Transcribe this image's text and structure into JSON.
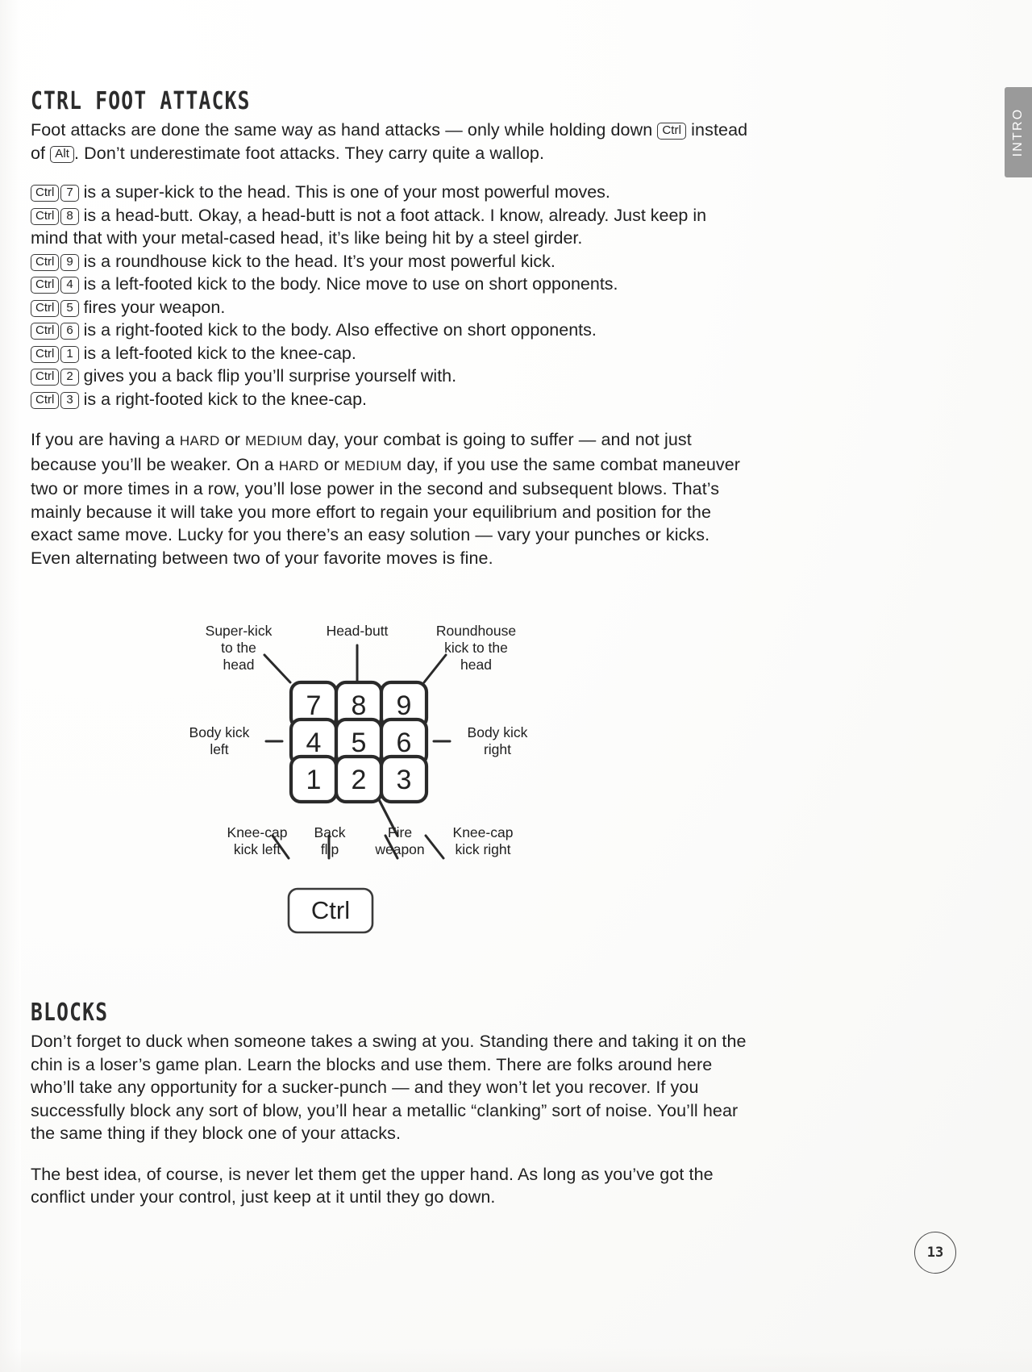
{
  "page": {
    "number": "13",
    "side_tab": "INTRO"
  },
  "sections": [
    {
      "id": "ctrl-foot-attacks",
      "heading": "CTRL FOOT ATTACKS",
      "intro": {
        "part1": "Foot attacks are done the same way as hand attacks — only while holding down ",
        "key1": "Ctrl",
        "part2": " instead of ",
        "key2": "Alt",
        "part3": ". Don’t underestimate foot attacks. They carry quite a wallop."
      },
      "key_list": [
        {
          "mod": "Ctrl",
          "key": "7",
          "text": " is a super-kick to the head. This is one of your most powerful moves."
        },
        {
          "mod": "Ctrl",
          "key": "8",
          "text": " is a head-butt. Okay, a head-butt is not a foot attack. I know, already. Just keep in mind that with your metal-cased head, it’s like being hit by a steel girder."
        },
        {
          "mod": "Ctrl",
          "key": "9",
          "text": " is a roundhouse kick to the head. It’s your most powerful kick."
        },
        {
          "mod": "Ctrl",
          "key": "4",
          "text": " is a left-footed kick to the body. Nice move to use on short opponents."
        },
        {
          "mod": "Ctrl",
          "key": "5",
          "text": " fires your weapon."
        },
        {
          "mod": "Ctrl",
          "key": "6",
          "text": " is a right-footed kick to the body. Also effective on short opponents."
        },
        {
          "mod": "Ctrl",
          "key": "1",
          "text": " is a left-footed kick to the knee-cap."
        },
        {
          "mod": "Ctrl",
          "key": "2",
          "text": " gives you a back flip you’ll surprise yourself with."
        },
        {
          "mod": "Ctrl",
          "key": "3",
          "text": " is a right-footed kick to the knee-cap."
        }
      ],
      "difficulty_paragraph": {
        "p1": "If you are having a ",
        "sc1": "HARD",
        "p2": " or ",
        "sc2": "MEDIUM",
        "p3": " day, your combat is going to suffer — and not just because you’ll be weaker. On a ",
        "sc3": "HARD",
        "p4": " or ",
        "sc4": "MEDIUM",
        "p5": " day, if you use the same combat maneuver two or more times in a row, you’ll lose power in the second and subsequent blows. That’s mainly because it will take you more effort to regain your equilibrium and position for the exact same move. Lucky for you there’s an easy solution — vary your punches or kicks. Even alternating between two of your favorite moves is fine."
      }
    },
    {
      "id": "blocks",
      "heading": "BLOCKS",
      "paragraphs": [
        "Don’t forget to duck when someone takes a swing at you. Standing there and taking it on the chin is a loser’s game plan. Learn the blocks and use them. There are folks around here who’ll take any opportunity for a sucker-punch — and they won’t let you recover. If you successfully block any sort of blow, you’ll hear a metallic “clanking” sort of noise. You’ll hear the same thing if they block one of your attacks.",
        "The best idea, of course, is never let them get the upper hand. As long as you’ve got the conflict under your control, just keep at it until they go down."
      ]
    }
  ],
  "keypad_diagram": {
    "modifier_key": "Ctrl",
    "keys": [
      {
        "key": "7",
        "row": 0,
        "col": 0
      },
      {
        "key": "8",
        "row": 0,
        "col": 1
      },
      {
        "key": "9",
        "row": 0,
        "col": 2
      },
      {
        "key": "4",
        "row": 1,
        "col": 0
      },
      {
        "key": "5",
        "row": 1,
        "col": 1
      },
      {
        "key": "6",
        "row": 1,
        "col": 2
      },
      {
        "key": "1",
        "row": 2,
        "col": 0
      },
      {
        "key": "2",
        "row": 2,
        "col": 1
      },
      {
        "key": "3",
        "row": 2,
        "col": 2
      }
    ],
    "callouts": {
      "super_kick": "Super-kick\nto the\nhead",
      "head_butt": "Head-butt",
      "roundhouse": "Roundhouse\nkick to the\nhead",
      "body_kick_left": "Body kick\nleft",
      "body_kick_right": "Body kick\nright",
      "knee_cap_left": "Knee-cap\nkick left",
      "back_flip": "Back\nflip",
      "fire_weapon": "Fire\nweapon",
      "knee_cap_right": "Knee-cap\nkick right"
    }
  }
}
